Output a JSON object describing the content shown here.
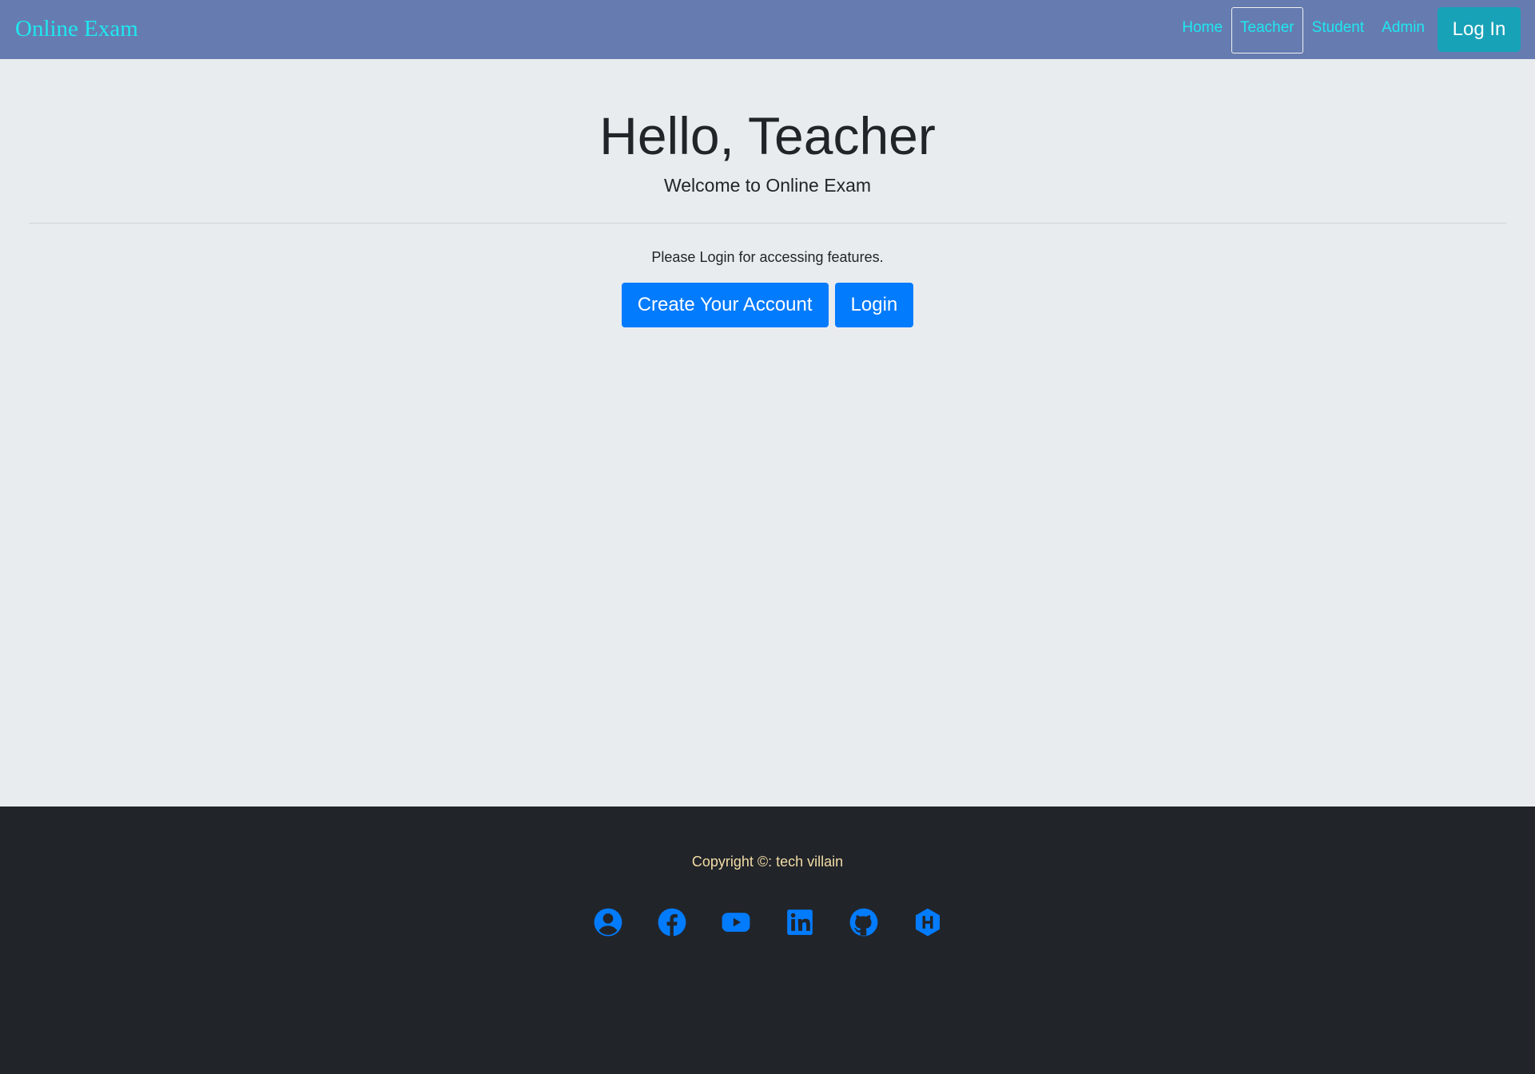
{
  "navbar": {
    "brand": "Online Exam",
    "links": [
      "Home",
      "Teacher",
      "Student",
      "Admin"
    ],
    "active_link": "Teacher",
    "login_button": "Log In"
  },
  "hero": {
    "greeting": "Hello, Teacher",
    "subtitle": "Welcome to Online Exam",
    "message": "Please Login for accessing features.",
    "create_account_button": "Create Your Account",
    "login_button": "Login"
  },
  "footer": {
    "copyright": "Copyright ©: tech villain",
    "social_icons": [
      "user-circle-icon",
      "facebook-icon",
      "youtube-icon",
      "linkedin-icon",
      "github-icon",
      "hackerrank-icon"
    ]
  },
  "colors": {
    "navbar_bg": "#667cb0",
    "nav_text": "#1ee8f0",
    "nav_login_bg": "#17a2b8",
    "primary": "#037bfd",
    "page_bg": "#e8ecef",
    "footer_bg": "#212429",
    "footer_text": "#f3dca6"
  }
}
